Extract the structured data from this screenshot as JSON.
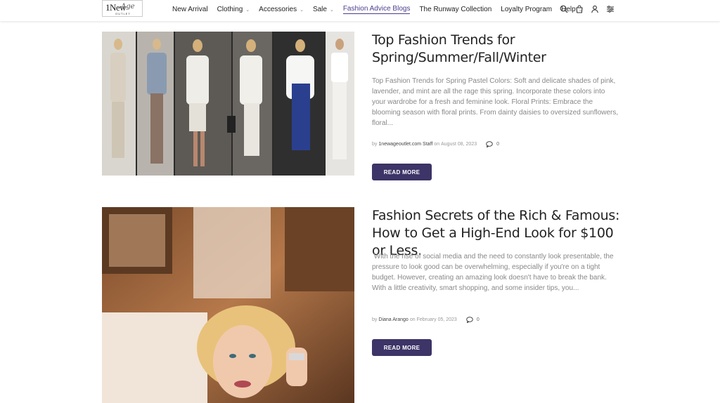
{
  "logo": {
    "text_main": "1New",
    "text_script": "Age",
    "text_sub": "OUTLET"
  },
  "nav": {
    "items": [
      {
        "label": "New Arrival",
        "chevron": false,
        "active": false
      },
      {
        "label": "Clothing",
        "chevron": true,
        "active": false
      },
      {
        "label": "Accessories",
        "chevron": true,
        "active": false
      },
      {
        "label": "Sale",
        "chevron": true,
        "active": false
      },
      {
        "label": "Fashion Advice Blogs",
        "chevron": false,
        "active": true
      },
      {
        "label": "The Runway Collection",
        "chevron": false,
        "active": false
      },
      {
        "label": "Loyalty Program",
        "chevron": false,
        "active": false
      },
      {
        "label": "Help",
        "chevron": true,
        "active": false
      }
    ],
    "icons": [
      "search-icon",
      "cart-icon",
      "user-icon",
      "filter-icon"
    ]
  },
  "posts": [
    {
      "title": "Top Fashion Trends for Spring/Summer/Fall/Winter",
      "excerpt": "Top Fashion Trends for Spring Pastel Colors: Soft and delicate shades of pink, lavender, and mint are all the rage this spring. Incorporate these colors into your wardrobe for a fresh and feminine look. Floral Prints: Embrace the blooming season with floral prints. From dainty daisies to oversized sunflowers, floral...",
      "by": "by",
      "author": "1newageoutlet.com Staff",
      "on": "on",
      "date": "August 08, 2023",
      "comments": "0",
      "button": "READ MORE"
    },
    {
      "title": "Fashion Secrets of the Rich & Famous: How to Get a High-End Look for $100 or Less.",
      "excerpt": " With the rise of social media and the need to constantly look presentable, the pressure to look good can be overwhelming, especially if you're on a tight budget. However, creating an amazing look doesn't have to break the bank. With a little creativity, smart shopping, and some insider tips, you...",
      "by": "by",
      "author": "Diana Arango",
      "on": "on",
      "date": "February 05, 2023",
      "comments": "0",
      "button": "READ MORE"
    }
  ],
  "colors": {
    "accent": "#4b3d8f",
    "button_bg": "#3d3467"
  }
}
